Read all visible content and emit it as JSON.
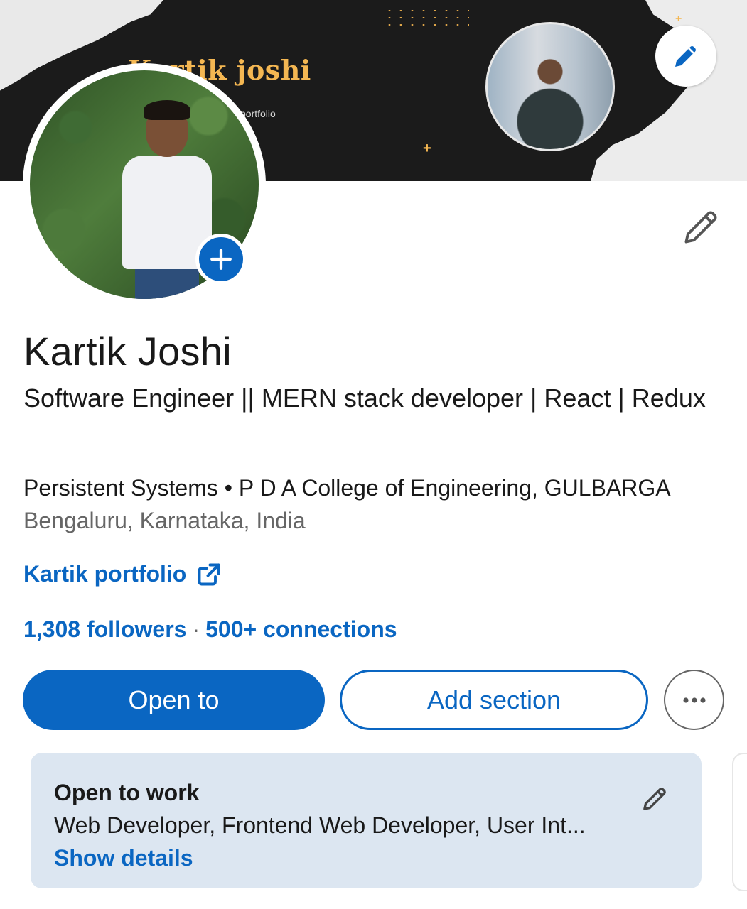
{
  "profile": {
    "banner_title": "Kartik joshi",
    "banner_subtitle": "portfolio",
    "name": "Kartik Joshi",
    "headline": "Software Engineer || MERN stack developer | React | Redux",
    "company": "Persistent Systems",
    "separator": "•",
    "education": "P D A College of Engineering, GULBARGA",
    "location": "Bengaluru, Karnataka, India",
    "website_label": "Kartik portfolio",
    "followers": "1,308 followers",
    "stats_separator": "·",
    "connections": "500+ connections"
  },
  "actions": {
    "open_to": "Open to",
    "add_section": "Add section",
    "more": "more-horizontal-icon"
  },
  "open_to_work": {
    "title": "Open to work",
    "roles": "Web Developer, Frontend Web Developer, User Int...",
    "show_details": "Show details"
  },
  "colors": {
    "accent": "#0a66c2",
    "banner_bg": "#1b1b1b",
    "banner_title": "#f4b752",
    "card_bg": "#dce6f1",
    "secondary_text": "#666666"
  },
  "icons": {
    "edit_cover": "pencil-icon",
    "add_photo": "plus-icon",
    "edit_intro": "pencil-icon",
    "external_link": "external-link-icon",
    "otw_edit": "pencil-icon"
  }
}
